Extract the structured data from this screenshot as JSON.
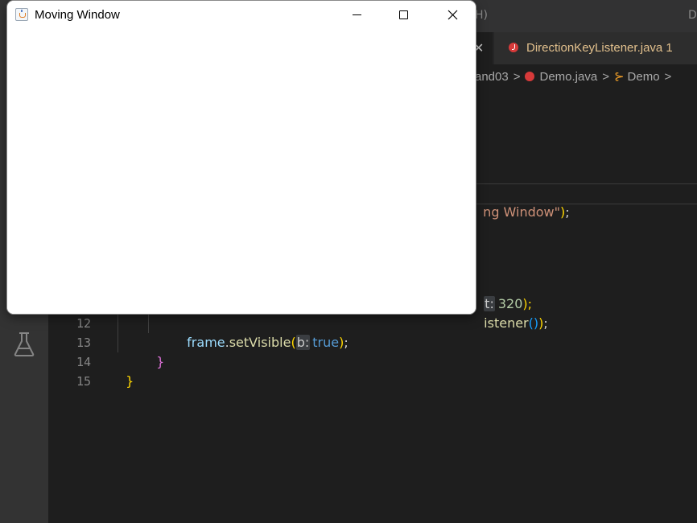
{
  "vscode": {
    "title_fragment": "H)",
    "title_right_fragment": "D",
    "tab_close_glyph": "✕",
    "tab": {
      "label": "DirectionKeyListener.java 1"
    },
    "breadcrumb": {
      "folder": "and03",
      "file": "Demo.java",
      "symbol": "Demo",
      "separator": ">"
    },
    "code": {
      "line_title": {
        "str": "ng Window\"",
        "tail_paren": ")",
        "tail_semi": ";"
      },
      "line_size": {
        "hint": "t:",
        "num": "320",
        "tail": ");"
      },
      "line_listener": {
        "text": "istener",
        "p1": "(",
        "p2": ")",
        "p3": ")",
        "semi": ";"
      },
      "line12": {
        "obj": "frame",
        "dot": ".",
        "fn": "setVisible",
        "open": "(",
        "hint": "b:",
        "val": "true",
        "close": ")",
        "semi": ";"
      },
      "line13": "}",
      "line14": "}"
    },
    "line_numbers": [
      "12",
      "13",
      "14",
      "15"
    ],
    "activity_icons": [
      "testing-flask-icon"
    ]
  },
  "java_window": {
    "title": "Moving Window",
    "icon": "java-cup-icon",
    "buttons": [
      "minimize",
      "maximize",
      "close"
    ]
  }
}
